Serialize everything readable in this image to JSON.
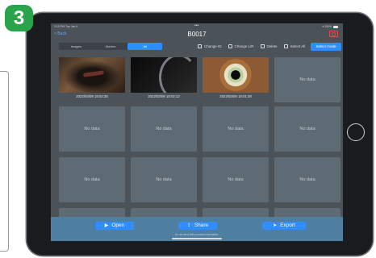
{
  "badge": {
    "number": "3",
    "color": "#2aa34a"
  },
  "status": {
    "time": "2:10 PM   Tue Jan 4",
    "dots": "•••",
    "indicators": "▾ 100%"
  },
  "nav": {
    "back_label": "< Back",
    "title": "B0017",
    "camera_icon": "camera-icon"
  },
  "segments": [
    {
      "label": "Images",
      "active": false
    },
    {
      "label": "Movies",
      "active": false
    },
    {
      "label": "All",
      "active": true
    }
  ],
  "tools": {
    "change_id": "Change ID",
    "change_lr": "Change L/R",
    "delete": "Delete",
    "select_all": "Select All",
    "select_mode": "Select mode"
  },
  "media": [
    {
      "caption": "2022/03/09 18:02:35"
    },
    {
      "caption": "2022/03/09 18:02:12"
    },
    {
      "caption": "2022/03/09 18:01:38"
    }
  ],
  "empty_label": "No data",
  "bottom": {
    "open": "Open",
    "share": "Share",
    "export": "Export",
    "footnote": "Do not send with personal information."
  },
  "colors": {
    "accent": "#2f8dff",
    "screen_bg": "#4b5258",
    "card": "#5e6b74",
    "bottom_bar": "#4e7ea0",
    "camera": "#e14b4b"
  }
}
